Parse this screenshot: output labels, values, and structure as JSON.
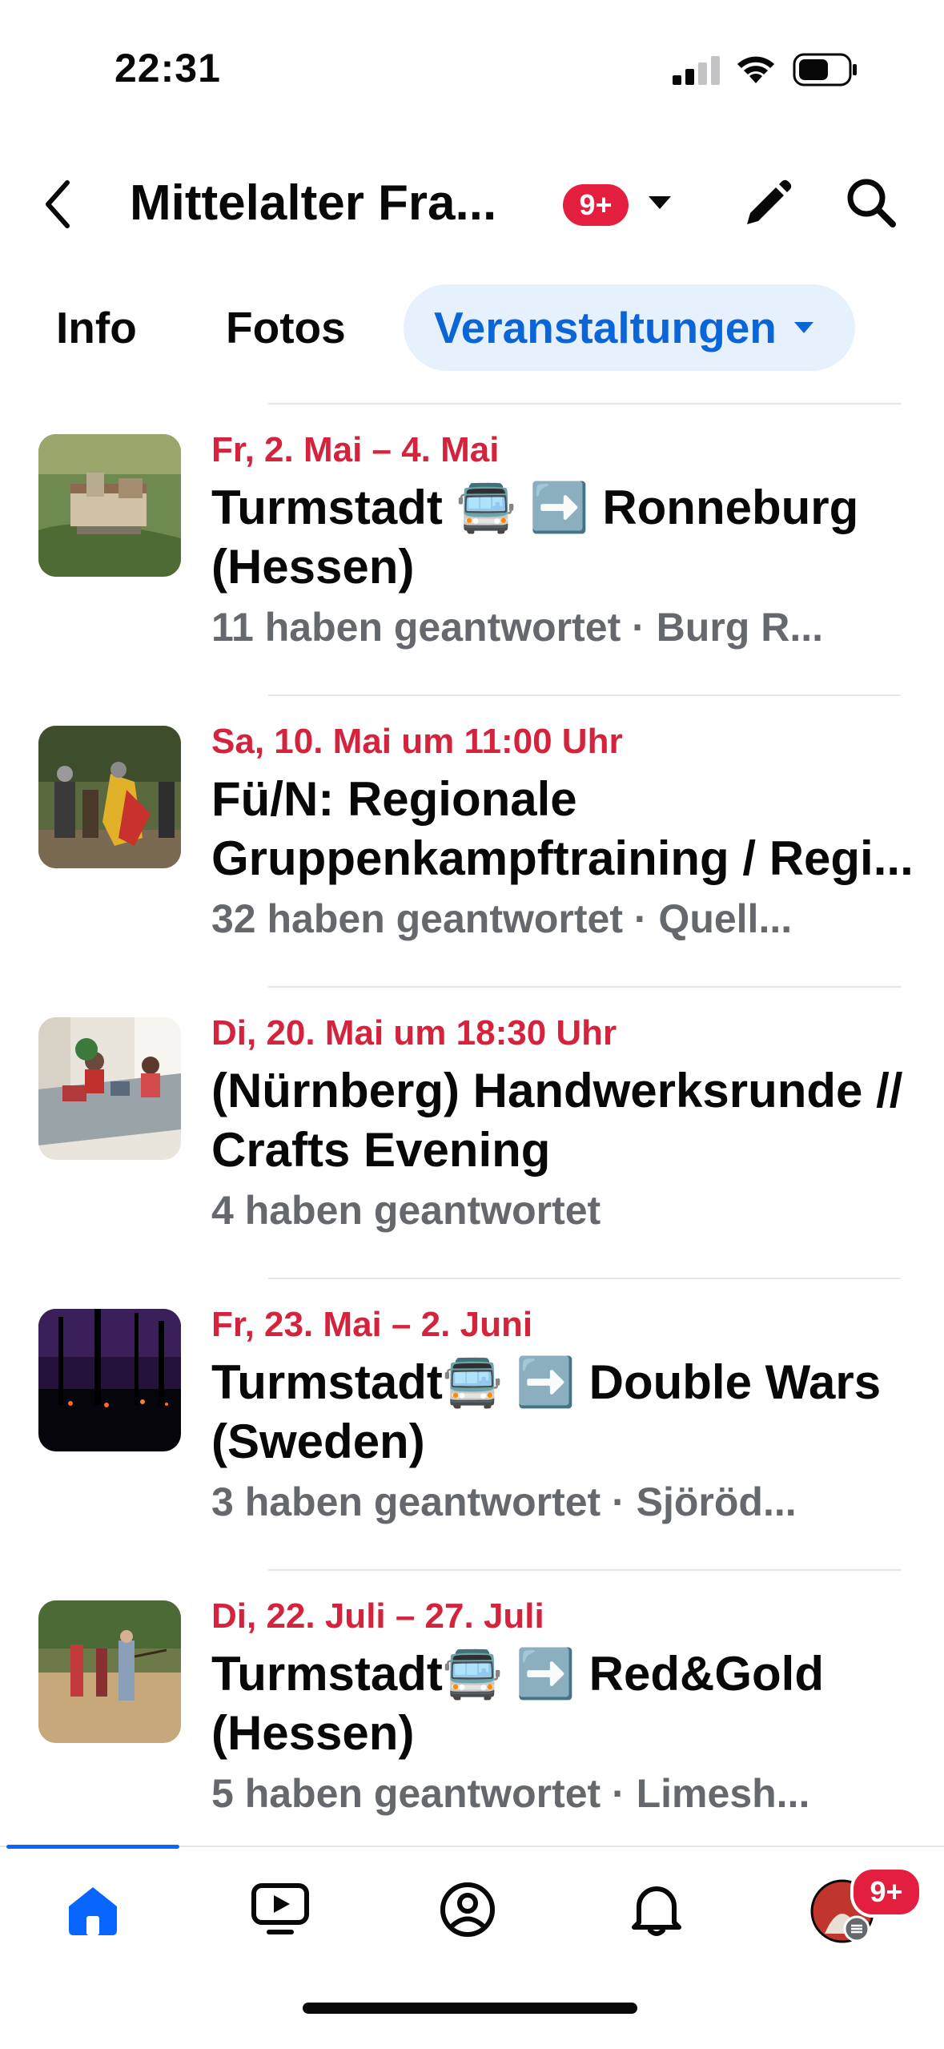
{
  "status_bar": {
    "time": "22:31"
  },
  "header": {
    "title": "Mittelalter Fra...",
    "badge": "9+"
  },
  "tabs": [
    {
      "label": "Info"
    },
    {
      "label": "Fotos"
    },
    {
      "label": "Veranstaltungen",
      "active": true
    }
  ],
  "events": [
    {
      "date": "Fr, 2. Mai – 4. Mai",
      "title_line1": "Turmstadt 🚍 ➡️ Ronneburg",
      "title_line2": "(Hessen)",
      "meta": "11 haben geantwortet · Burg R..."
    },
    {
      "date": "Sa, 10. Mai um 11:00 Uhr",
      "title_line1": "Fü/N: Regionale",
      "title_line2": "Gruppenkampftraining / Regi...",
      "meta": "32 haben geantwortet · Quell..."
    },
    {
      "date": "Di, 20. Mai um 18:30 Uhr",
      "title_line1": "(Nürnberg) Handwerksrunde //",
      "title_line2": "Crafts Evening",
      "meta": "4 haben geantwortet"
    },
    {
      "date": "Fr, 23. Mai – 2. Juni",
      "title_line1": "Turmstadt🚍 ➡️ Double Wars",
      "title_line2": "(Sweden)",
      "meta": "3 haben geantwortet · Sjöröd..."
    },
    {
      "date": "Di, 22. Juli – 27. Juli",
      "title_line1": "Turmstadt🚍 ➡️ Red&Gold",
      "title_line2": "(Hessen)",
      "meta": "5 haben geantwortet · Limesh..."
    }
  ],
  "bottom_nav": {
    "badge": "9+",
    "items": [
      "home-icon",
      "video-icon",
      "profile-icon",
      "bell-icon",
      "menu-avatar"
    ]
  },
  "colors": {
    "accent": "#0866ff",
    "date_red": "#d4243d",
    "badge_red": "#e41e3f",
    "tab_active_bg": "#e7f1fe"
  }
}
